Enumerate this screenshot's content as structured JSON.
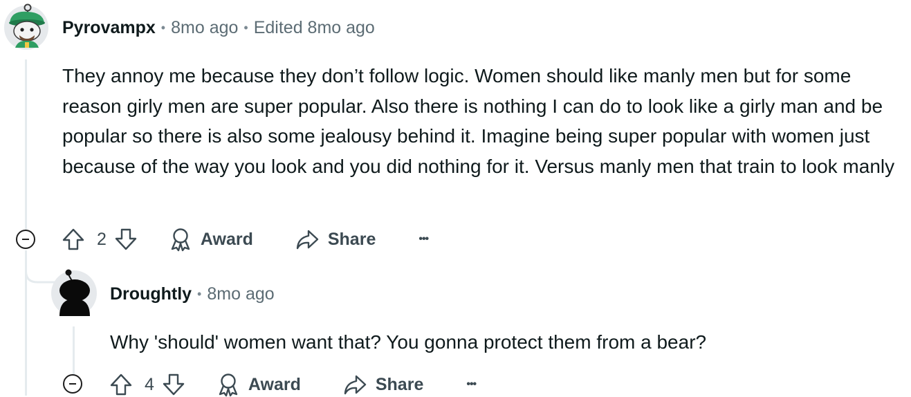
{
  "comments": [
    {
      "author": "Pyrovampx",
      "age": "8mo ago",
      "edited": "Edited 8mo ago",
      "avatar": "snoo-green-hat-avatar",
      "body": "They annoy me because they don’t follow logic. Women should like manly men but for some reason girly men are super popular. Also there is nothing I can do to look like a girly man and be popular so there is also some jealousy behind it. Imagine being super popular with women just because of the way you look and you did nothing for it. Versus manly men that train to look manly",
      "score": "2",
      "award_label": "Award",
      "share_label": "Share",
      "more_label": "•••"
    },
    {
      "author": "Droughtly",
      "age": "8mo ago",
      "avatar": "snoo-black-avatar",
      "body": "Why 'should' women want that? You gonna protect them from a bear?",
      "score": "4",
      "award_label": "Award",
      "share_label": "Share",
      "more_label": "•••"
    }
  ],
  "separator": "•",
  "colors": {
    "text": "#0f1a1c",
    "meta": "#5c6c74",
    "action": "#3c4a52",
    "thread_line": "#e5ebee"
  }
}
